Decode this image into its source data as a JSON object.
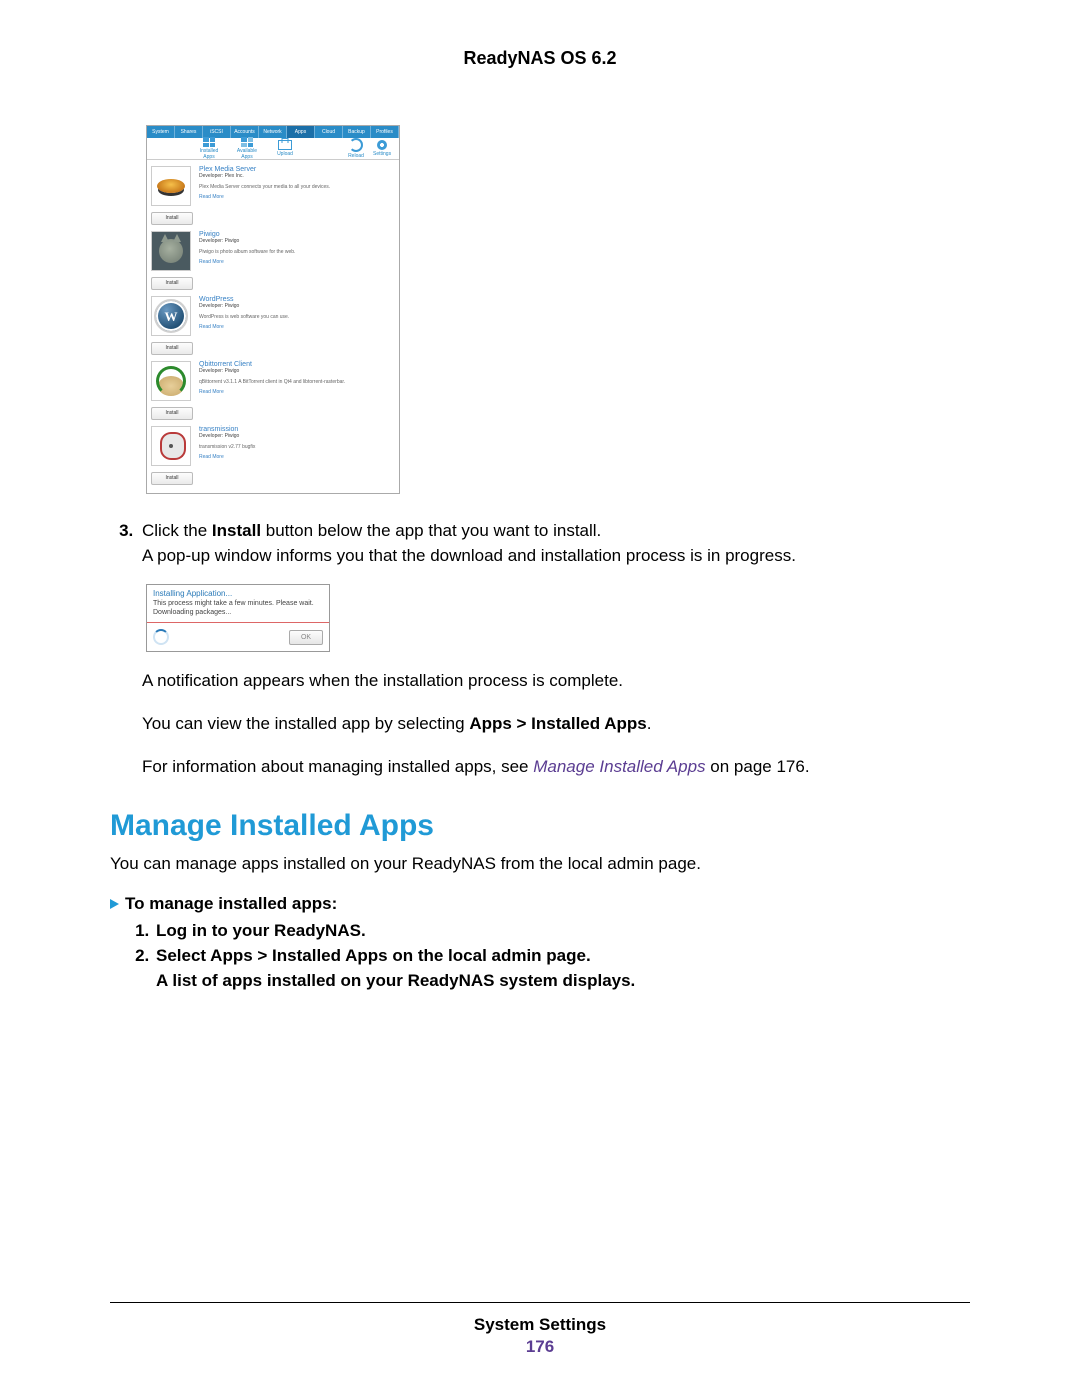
{
  "header": {
    "title": "ReadyNAS OS 6.2"
  },
  "screenshot": {
    "tabs": [
      "System",
      "Shares",
      "iSCSI",
      "Accounts",
      "Network",
      "Apps",
      "Cloud",
      "Backup",
      "Profiles"
    ],
    "active_tab_index": 5,
    "toolbar": {
      "installed": "Installed Apps",
      "available": "Available Apps",
      "upload": "Upload",
      "reload": "Reload",
      "settings": "Settings"
    },
    "apps": [
      {
        "name": "Plex Media Server",
        "dev": "Developer: Plex Inc.",
        "desc": "Plex Media Server connects your media to all your devices.",
        "more": "Read More",
        "install": "Install"
      },
      {
        "name": "Piwigo",
        "dev": "Developer: Piwigo",
        "desc": "Piwigo is photo album software for the web.",
        "more": "Read More",
        "install": "Install"
      },
      {
        "name": "WordPress",
        "dev": "Developer: Piwigo",
        "desc": "WordPress is web software you can use.",
        "more": "Read More",
        "install": "Install"
      },
      {
        "name": "Qbittorrent Client",
        "dev": "Developer: Piwigo",
        "desc": "qBittorrent v3.1.1 A BitTorrent client in Qt4 and libtorrent-rasterbar.",
        "more": "Read More",
        "install": "Install"
      },
      {
        "name": "transmission",
        "dev": "Developer: Piwigo",
        "desc": "transmission v2.77 bugfix",
        "more": "Read More",
        "install": "Install"
      }
    ]
  },
  "step3": {
    "number": "3.",
    "pre": "Click the ",
    "bold1": "Install",
    "post1": " button below the app that you want to install.",
    "line2": "A pop-up window informs you that the download and installation process is in progress."
  },
  "popup": {
    "title": "Installing Application...",
    "msg": "This process might take a few minutes. Please wait.",
    "status": "Downloading packages...",
    "ok": "OK"
  },
  "after": {
    "l1": "A notification appears when the installation process is complete.",
    "l2a": "You can view the installed app by selecting ",
    "l2b": "Apps > Installed Apps",
    "l2c": ".",
    "l3a": "For information about managing installed apps, see ",
    "l3link": "Manage Installed Apps",
    "l3b": " on page 176."
  },
  "section": {
    "heading": "Manage Installed Apps",
    "intro": "You can manage apps installed on your ReadyNAS from the local admin page.",
    "proc_head": "To manage installed apps:",
    "steps": [
      "Log in to your ReadyNAS.",
      "Select Apps > Installed Apps on the local admin page.",
      "A list of apps installed on your ReadyNAS system displays."
    ]
  },
  "footer": {
    "section": "System Settings",
    "page": "176"
  }
}
